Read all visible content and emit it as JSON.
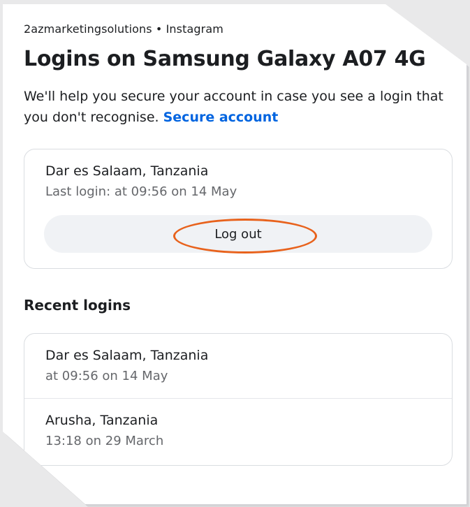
{
  "header": {
    "breadcrumb": "2azmarketingsolutions • Instagram",
    "title": "Logins on Samsung Galaxy A07 4G"
  },
  "description": {
    "text": "We'll help you secure your account in case you see a login that you don't recognise.",
    "link_label": "Secure account"
  },
  "current_session": {
    "location": "Dar es Salaam, Tanzania",
    "last_login": "Last login: at 09:56 on 14 May",
    "logout_label": "Log out"
  },
  "recent": {
    "heading": "Recent logins",
    "items": [
      {
        "location": "Dar es Salaam, Tanzania",
        "time": "at 09:56 on 14 May"
      },
      {
        "location": "Arusha, Tanzania",
        "time": "13:18 on 29 March"
      }
    ]
  },
  "colors": {
    "link": "#0064e0",
    "highlight_ring": "#e8621c",
    "button_bg": "#f0f2f5"
  }
}
